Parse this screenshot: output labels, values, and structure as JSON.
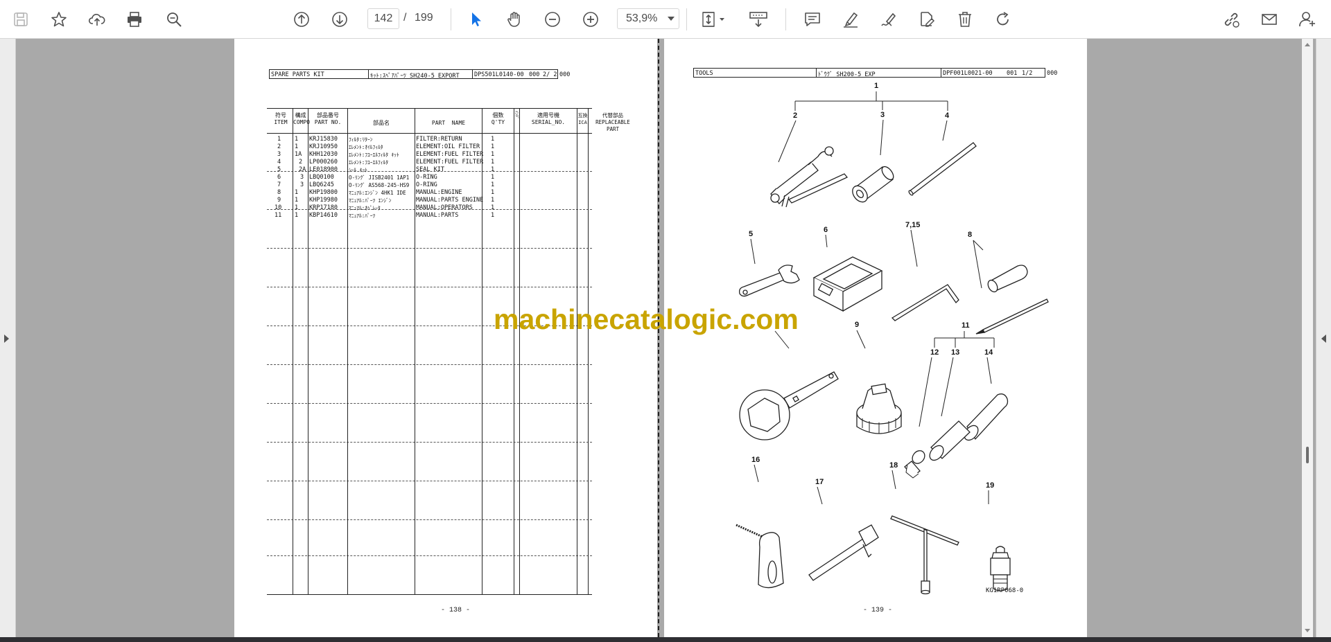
{
  "toolbar": {
    "left_icons": [
      "save-icon",
      "bookmark-star-icon",
      "upload-cloud-icon",
      "print-icon",
      "zoom-search-icon"
    ],
    "nav_icons": [
      "page-up-icon",
      "page-down-icon"
    ],
    "current_page": "142",
    "page_separator": "/",
    "total_pages": "199",
    "tool_icons": [
      "select-arrow-icon",
      "hand-tool-icon",
      "zoom-out-icon",
      "zoom-in-icon"
    ],
    "zoom": "53,9%",
    "right_icons": [
      "page-fit-icon",
      "scroll-mode-icon",
      "comment-icon",
      "highlight-pen-icon",
      "sign-pen-icon",
      "edit-pdf-icon",
      "delete-trash-icon",
      "rotate-icon"
    ],
    "far_right_icons": [
      "share-link-icon",
      "email-icon",
      "account-icon"
    ],
    "accent_color": "#1473e6"
  },
  "left_page": {
    "header": {
      "title": "SPARE PARTS KIT",
      "kit": "ｷｯﾄ:ｽﾍﾟｱﾊﾟｰﾂ SH240-5 EXPORT",
      "code": "DPS501L0140-00",
      "num": "000",
      "sheet": "2/ 2",
      "trail": "000"
    },
    "columns": {
      "item": "符号\nITEM",
      "comp": "構成\nCOMPO",
      "partno": "部品番号\nPART NO.",
      "jname": "部品名",
      "ename": "PART  NAME",
      "qty": "個数\nQ'TY",
      "ic": "ｲﾝﾁﾞ",
      "serial": "適用号機\nSERIAL_NO.",
      "ica": "互換\nICA",
      "repl": "代替部品\nREPLACEABLE\nPART"
    },
    "rows": [
      {
        "item": "1",
        "comp": "1",
        "partno": "KRJ15830",
        "jname": "ﾌｨﾙﾀ:ﾘﾀｰﾝ",
        "ename": "FILTER:RETURN",
        "qty": "1"
      },
      {
        "item": "2",
        "comp": "1",
        "partno": "KRJ10950",
        "jname": "ｴﾚﾒﾝﾄ:ｵｲﾙﾌｨﾙﾀ",
        "ename": "ELEMENT:OIL FILTER",
        "qty": "1"
      },
      {
        "item": "3",
        "comp": "1A",
        "partno": "KHH12030",
        "jname": "ｴﾚﾒﾝﾄ:ﾌﾕｰｴﾙﾌｨﾙﾀ ｷｯﾄ",
        "ename": "ELEMENT:FUEL FILTER",
        "qty": "1"
      },
      {
        "item": "4",
        "comp": "2",
        "partno": "LP000260",
        "jname": "ｴﾚﾒﾝﾄ:ﾌﾕｰｴﾙﾌｨﾙﾀ",
        "ename": "ELEMENT:FUEL FILTER",
        "qty": "1"
      },
      {
        "item": "5",
        "comp": "2A",
        "partno": "LE018900",
        "jname": "ｼｰﾙ ｷｯﾄ",
        "ename": "SEAL KIT",
        "qty": "1"
      },
      {
        "item": "6",
        "comp": "3",
        "partno": "LBQ0100",
        "jname": "O-ﾘﾝｸﾞ JISB2401 1AP1",
        "ename": "O-RING",
        "qty": "1"
      },
      {
        "item": "7",
        "comp": "3",
        "partno": "LBQ6245",
        "jname": "O-ﾘﾝｸﾞ AS568-245-HS9",
        "ename": "O-RING",
        "qty": "1"
      },
      {
        "item": "8",
        "comp": "1",
        "partno": "KHP19800",
        "jname": "ﾏﾆｭｱﾙ:ｴﾝｼﾞﾝ 4HK1 IDE",
        "ename": "MANUAL:ENGINE",
        "qty": "1"
      },
      {
        "item": "9",
        "comp": "1",
        "partno": "KHP19980",
        "jname": "ﾏﾆｭｱﾙ:ﾊﾟｰﾂ ｴﾝｼﾞﾝ",
        "ename": "MANUAL:PARTS ENGINE",
        "qty": "1"
      },
      {
        "item": "10",
        "comp": "1",
        "partno": "KRP17180",
        "jname": "ﾏﾆｭｱﾙ:ｵﾍﾟﾚｰﾀ",
        "ename": "MANUAL:OPERATORS",
        "qty": "1"
      },
      {
        "item": "11",
        "comp": "1",
        "partno": "KBP14610",
        "jname": "ﾏﾆｭｱﾙ:ﾊﾟｰﾂ",
        "ename": "MANUAL:PARTS",
        "qty": "1"
      }
    ],
    "page_number": "- 138 -"
  },
  "right_page": {
    "header": {
      "title": "TOOLS",
      "kit": "ﾄﾞｳｸﾞ SH200-5 EXP",
      "code": "DPF001L0021-00",
      "num": "001",
      "sheet": "1/2",
      "trail": "000"
    },
    "callouts": [
      "1",
      "2",
      "3",
      "4",
      "5",
      "6",
      "7,15",
      "8",
      "9",
      "11",
      "12",
      "13",
      "14",
      "16",
      "17",
      "18",
      "19"
    ],
    "figure_code": "KG1RP068-0",
    "page_number": "- 139 -"
  },
  "watermark": "machinecatalogic.com"
}
